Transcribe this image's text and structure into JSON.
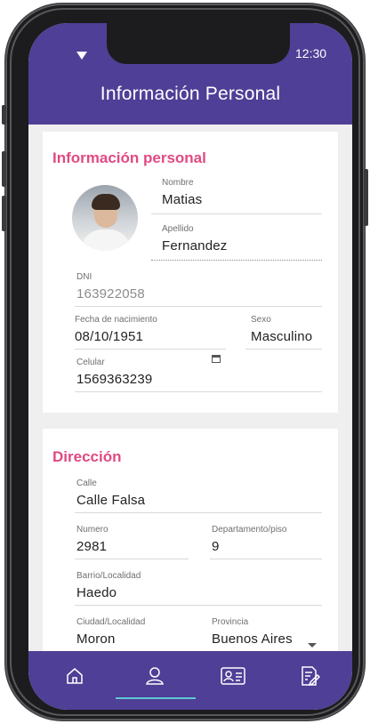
{
  "status_bar": {
    "time": "12:30"
  },
  "header": {
    "title": "Información Personal"
  },
  "personal": {
    "section_title": "Información personal",
    "nombre": {
      "label": "Nombre",
      "value": "Matias"
    },
    "apellido": {
      "label": "Apellido",
      "value": "Fernandez"
    },
    "dni": {
      "label": "DNI",
      "value": "163922058"
    },
    "fecha": {
      "label": "Fecha de nacimiento",
      "value": "08/10/1951"
    },
    "sexo": {
      "label": "Sexo",
      "value": "Masculino"
    },
    "celular": {
      "label": "Celular",
      "value": "1569363239"
    }
  },
  "address": {
    "section_title": "Dirección",
    "calle": {
      "label": "Calle",
      "value": "Calle Falsa"
    },
    "numero": {
      "label": "Numero",
      "value": "2981"
    },
    "depto": {
      "label": "Departamento/piso",
      "value": "9"
    },
    "barrio": {
      "label": "Barrio/Localidad",
      "value": "Haedo"
    },
    "ciudad": {
      "label": "Ciudad/Localidad",
      "value": "Moron"
    },
    "provincia": {
      "label": "Provincia",
      "value": "Buenos Aires"
    }
  },
  "nav": {
    "items": [
      "home-icon",
      "profile-icon",
      "id-card-icon",
      "document-edit-icon"
    ],
    "active": "profile-icon"
  },
  "colors": {
    "primary": "#4f3f96",
    "accent": "#e04a82",
    "indicator": "#5fc7d4"
  }
}
